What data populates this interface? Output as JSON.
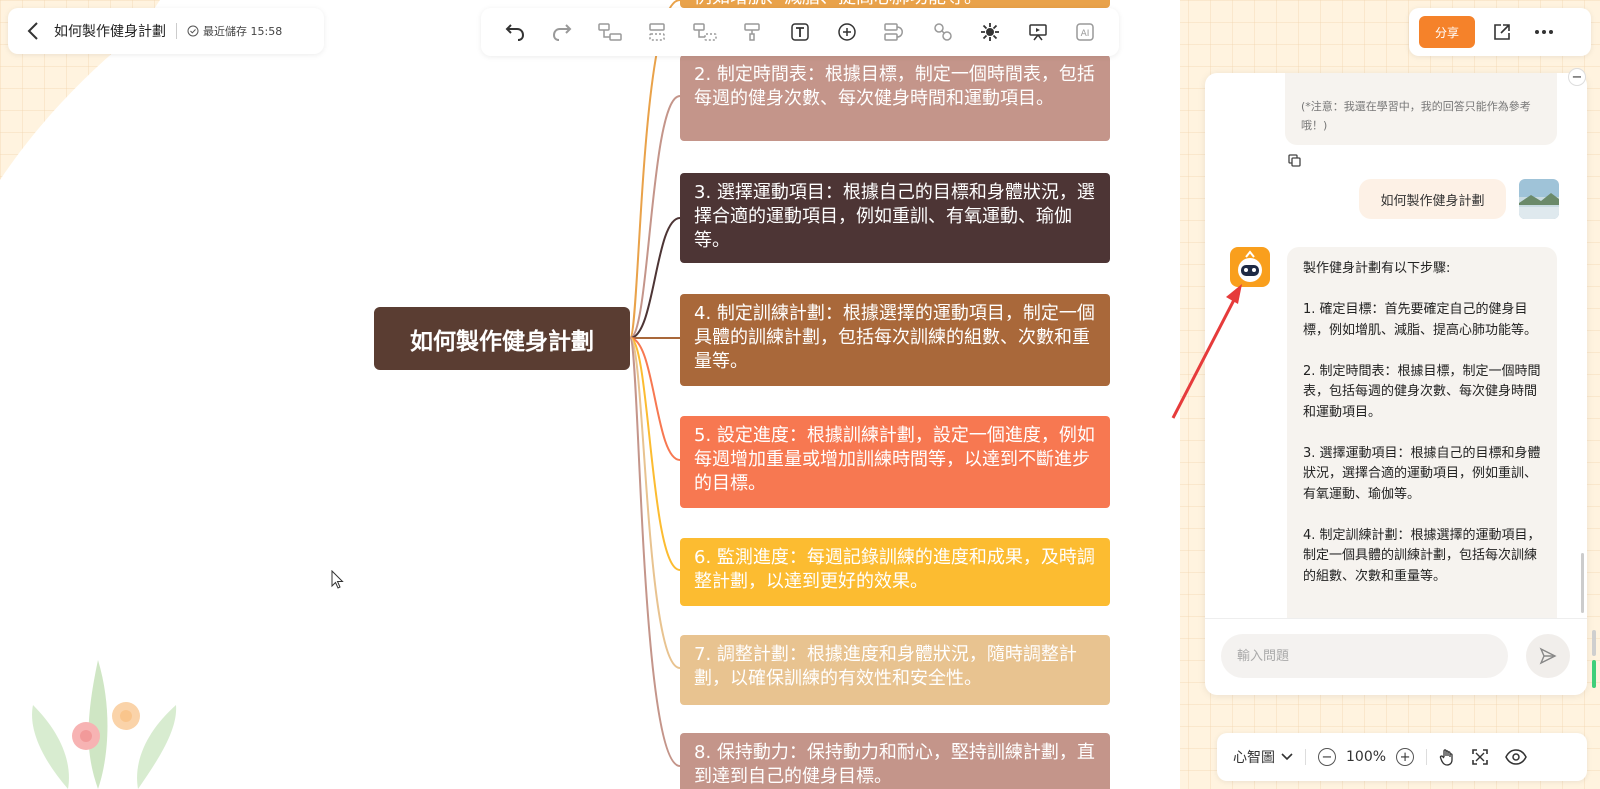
{
  "header": {
    "doc_title": "如何製作健身計劃",
    "save_status": "最近儲存 15:58"
  },
  "toolbar": {
    "tools": [
      "undo-icon",
      "redo-icon",
      "insert-child-icon",
      "insert-sibling-icon",
      "insert-parent-icon",
      "format-painter-icon",
      "text-icon",
      "add-icon",
      "relationship-icon",
      "link-icon",
      "summary-icon",
      "presentation-icon",
      "ai-icon"
    ],
    "ai_label": "AI"
  },
  "top_right": {
    "share_label": "分享"
  },
  "mindmap": {
    "root": "如何製作健身計劃",
    "branches": [
      {
        "text": "例如增肌、減脂、提高心肺功能等。",
        "color": "#e9a24a"
      },
      {
        "text": "2. 制定時間表：根據目標，制定一個時間表，包括每週的健身次數、每次健身時間和運動項目。",
        "color": "#c4958a"
      },
      {
        "text": "3. 選擇運動項目：根據自己的目標和身體狀況，選擇合適的運動項目，例如重訓、有氧運動、瑜伽等。",
        "color": "#4d3535"
      },
      {
        "text": "4. 制定訓練計劃：根據選擇的運動項目，制定一個具體的訓練計劃，包括每次訓練的組數、次數和重量等。",
        "color": "#a9683a"
      },
      {
        "text": "5. 設定進度：根據訓練計劃，設定一個進度，例如每週增加重量或增加訓練時間等，以達到不斷進步的目標。",
        "color": "#f77851"
      },
      {
        "text": "6. 監測進度：每週記錄訓練的進度和成果，及時調整計劃，以達到更好的效果。",
        "color": "#fcbc31"
      },
      {
        "text": "7. 調整計劃：根據進度和身體狀況，隨時調整計劃，以確保訓練的有效性和安全性。",
        "color": "#e8c390"
      },
      {
        "text": "8. 保持動力：保持動力和耐心，堅持訓練計劃，直到達到自己的健身目標。",
        "color": "#c4958a"
      }
    ]
  },
  "chat": {
    "note": "(*注意：我還在學習中，我的回答只能作為參考哦！)",
    "user_message": "如何製作健身計劃",
    "bot_intro": "製作健身計劃有以下步驟:",
    "bot_steps": [
      "1. 確定目標：首先要確定自己的健身目標，例如增肌、減脂、提高心肺功能等。",
      "2. 制定時間表：根據目標，制定一個時間表，包括每週的健身次數、每次健身時間和運動項目。",
      "3. 選擇運動項目：根據自己的目標和身體狀況，選擇合適的運動項目，例如重訓、有氧運動、瑜伽等。",
      "4. 制定訓練計劃：根據選擇的運動項目，制定一個具體的訓練計劃，包括每次訓練的組數、次數和重量等。"
    ],
    "input_placeholder": "輸入問題"
  },
  "bottom_bar": {
    "mode_label": "心智圖",
    "zoom_label": "100%"
  }
}
